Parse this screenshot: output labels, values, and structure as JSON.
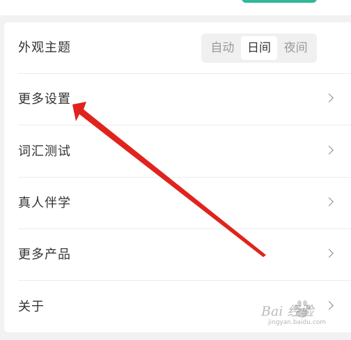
{
  "settings": {
    "theme": {
      "label": "外观主题",
      "options": [
        "自动",
        "日间",
        "夜间"
      ],
      "selected": "日间"
    },
    "rows": [
      {
        "label": "更多设置"
      },
      {
        "label": "词汇测试"
      },
      {
        "label": "真人伴学"
      },
      {
        "label": "更多产品"
      },
      {
        "label": "关于"
      }
    ]
  },
  "watermark": {
    "main": "Bai 经验",
    "sub": "jingyan.baidu.com"
  },
  "colors": {
    "accent": "#2fb89a",
    "annotation_arrow": "#e0231c"
  },
  "icons": {
    "row_chevron": "chevron-right-icon",
    "watermark_logo": "baidu-paw-icon"
  }
}
